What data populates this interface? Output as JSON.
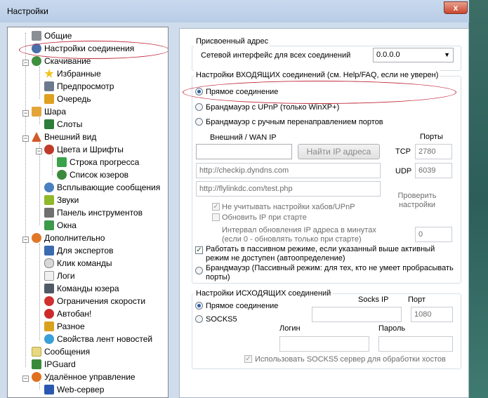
{
  "window": {
    "title": "Настройки",
    "close_label": "x"
  },
  "tree": {
    "items": [
      {
        "label": "Общие"
      },
      {
        "label": "Настройки соединения"
      },
      {
        "label": "Скачивание"
      },
      {
        "label": "Избранные"
      },
      {
        "label": "Предпросмотр"
      },
      {
        "label": "Очередь"
      },
      {
        "label": "Шара"
      },
      {
        "label": "Слоты"
      },
      {
        "label": "Внешний вид"
      },
      {
        "label": "Цвета и Шрифты"
      },
      {
        "label": "Строка прогресса"
      },
      {
        "label": "Список юзеров"
      },
      {
        "label": "Всплывающие сообщения"
      },
      {
        "label": "Звуки"
      },
      {
        "label": "Панель инструментов"
      },
      {
        "label": "Окна"
      },
      {
        "label": "Дополнительно"
      },
      {
        "label": "Для экспертов"
      },
      {
        "label": "Клик команды"
      },
      {
        "label": "Логи"
      },
      {
        "label": "Команды юзера"
      },
      {
        "label": "Ограничения скорости"
      },
      {
        "label": "Автобан!"
      },
      {
        "label": "Разное"
      },
      {
        "label": "Свойства лент новостей"
      },
      {
        "label": "Сообщения"
      },
      {
        "label": "IPGuard"
      },
      {
        "label": "Удалённое управление"
      },
      {
        "label": "Web-сервер"
      }
    ],
    "selected": "Настройки соединения"
  },
  "assigned": {
    "legend": "Присвоенный адрес",
    "iface_label": "Сетевой интерфейс для всех соединений",
    "iface_value": "0.0.0.0"
  },
  "incoming": {
    "legend": "Настройки ВХОДЯЩИХ соединений (см. Help/FAQ, если не уверен)",
    "opt_direct": "Прямое соединение",
    "opt_upnp": "Брандмауэр с UPnP (только WinXP+)",
    "opt_manual": "Брандмауэр с ручным перенаправлением портов",
    "wan_label": "Внешний / WAN IP",
    "ports_label": "Порты",
    "wan_value": "",
    "find_ip_button": "Найти IP адреса",
    "tcp_label": "TCP",
    "tcp_value": "2780",
    "udp_label": "UDP",
    "udp_value": "6039",
    "url1": "http://checkip.dyndns.com",
    "url2": "http://flylinkdc.com/test.php",
    "check_settings_1": "Проверить",
    "check_settings_2": "настройки",
    "ignore_hub": "Не учитывать настройки хабов/UPnP",
    "update_ip": "Обновить IP при старте",
    "interval_1": "Интервал обновления IP адреса в минутах",
    "interval_2": "(если 0 - обновлять только при старте)",
    "interval_value": "0",
    "passive_1": "Работать в пассивном режиме, если указанный выше активный",
    "passive_2": "режим не доступен (автоопределение)",
    "firewall_passive_1": "Брандмауэр (Пассивный режим: для тех, кто не умеет пробрасывать",
    "firewall_passive_2": "порты)"
  },
  "outgoing": {
    "legend": "Настройки ИСХОДЯЩИХ соединений",
    "opt_direct": "Прямое соединение",
    "opt_socks": "SOCKS5",
    "socks_ip_label": "Socks IP",
    "port_label": "Порт",
    "port_value": "1080",
    "login_label": "Логин",
    "password_label": "Пароль",
    "use_socks": "Использовать SOCKS5 сервер для обработки хостов"
  },
  "colors": {
    "accent": "#2a5fa8",
    "highlight": "#c0283a",
    "window_bg": "#cfdcec"
  }
}
